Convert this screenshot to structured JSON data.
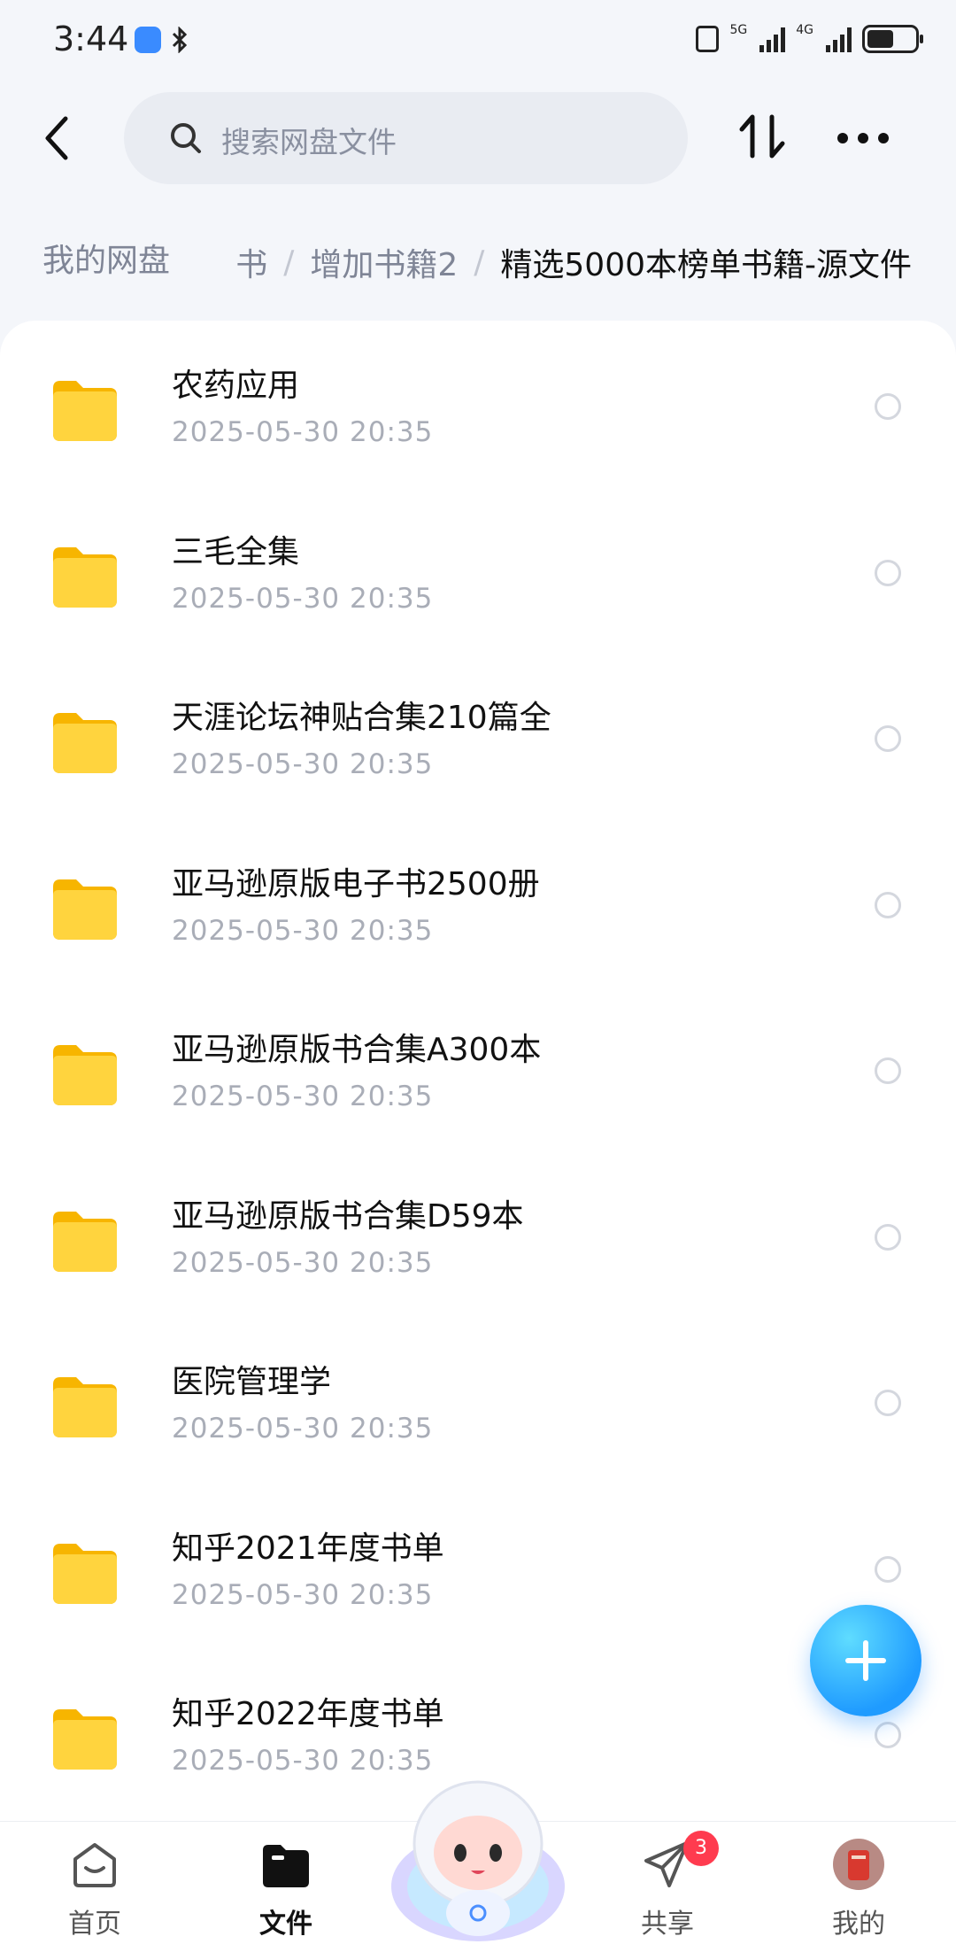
{
  "status_bar": {
    "time": "3:44",
    "net_5g": "5G",
    "net_4g": "4G",
    "battery_level_percent": 55
  },
  "search": {
    "placeholder": "搜索网盘文件"
  },
  "breadcrumb": {
    "root": "我的网盘",
    "items": [
      "书",
      "增加书籍2"
    ],
    "current": "精选5000本榜单书籍-源文件"
  },
  "files": [
    {
      "name": "农药应用",
      "date": "2025-05-30  20:35"
    },
    {
      "name": "三毛全集",
      "date": "2025-05-30  20:35"
    },
    {
      "name": "天涯论坛神贴合集210篇全",
      "date": "2025-05-30  20:35"
    },
    {
      "name": "亚马逊原版电子书2500册",
      "date": "2025-05-30  20:35"
    },
    {
      "name": "亚马逊原版书合集A300本",
      "date": "2025-05-30  20:35"
    },
    {
      "name": "亚马逊原版书合集D59本",
      "date": "2025-05-30  20:35"
    },
    {
      "name": "医院管理学",
      "date": "2025-05-30  20:35"
    },
    {
      "name": "知乎2021年度书单",
      "date": "2025-05-30  20:35"
    },
    {
      "name": "知乎2022年度书单",
      "date": "2025-05-30  20:35"
    }
  ],
  "bottom_nav": {
    "home": "首页",
    "files": "文件",
    "share": "共享",
    "share_badge": "3",
    "mine": "我的"
  },
  "colors": {
    "accent": "#1f9bff",
    "folder": "#ffcd3c",
    "badge": "#ff3b4f"
  }
}
